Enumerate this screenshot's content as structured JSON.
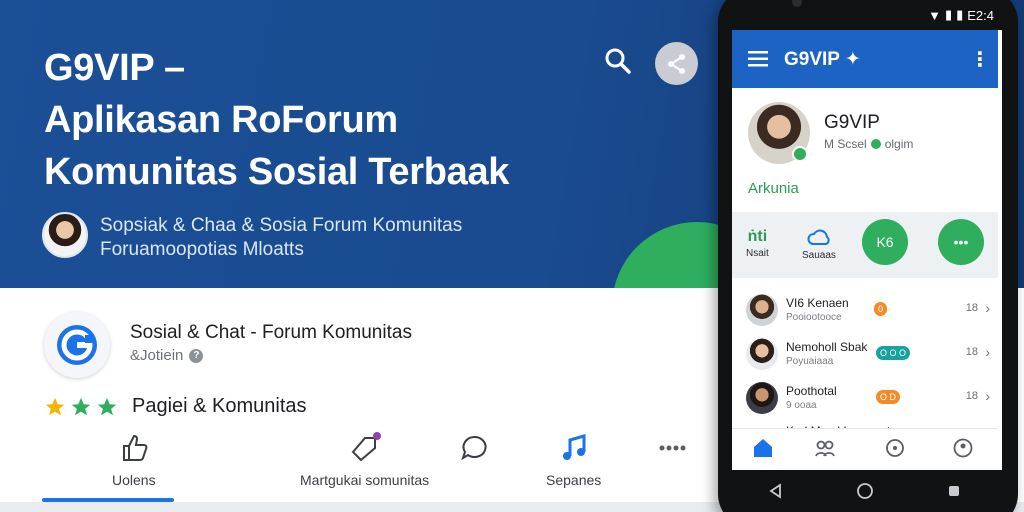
{
  "hero": {
    "title_lines": [
      "G9VIP –",
      "Aplikasan RoForum",
      "Komunitas Sosial Terbaak"
    ],
    "subtitle_lines": [
      "Sopsiak & Chaa & Sosia Forum Komunitas",
      "Foruamoopotias Mloatts"
    ],
    "icons": {
      "search": "search-icon",
      "share": "share-icon"
    },
    "accent_color": "#2fae5e",
    "background_color": "#1b4f96"
  },
  "listing": {
    "app_name": "Sosial & Chat - Forum Komunitas",
    "developer": "&Jotiein",
    "rating_text": "Pagiei & Komunitas",
    "stars": 3,
    "actions": [
      {
        "label": "Uolens",
        "icon": "thumbs-up-icon"
      },
      {
        "label": "Martgukai somunitas",
        "icon": "tag-icon"
      },
      {
        "label": "",
        "icon": "chat-icon"
      },
      {
        "label": "Sepanes",
        "icon": "music-note-icon"
      },
      {
        "label": "",
        "icon": "more-icon"
      }
    ]
  },
  "phone": {
    "status_text": "E2:4",
    "app_bar_title": "G9VIP ✦",
    "profile": {
      "name": "G9VIP",
      "handle": "M Scsel",
      "handle_suffix": "olgim",
      "section": "Arkunia"
    },
    "quick_actions": [
      {
        "label": "Nsait",
        "glyph": "ṅti"
      },
      {
        "label": "Sauaas",
        "glyph": ""
      },
      {
        "label": "",
        "glyph": "K6"
      },
      {
        "label": "",
        "glyph": "•••"
      }
    ],
    "chats": [
      {
        "name": "VI6 Kenaen",
        "sub": "Pooiootooce",
        "time": "18",
        "badge": "0"
      },
      {
        "name": "Nemoholl Sbak",
        "sub": "Poyuaiaaa",
        "time": "18",
        "badge": "O O O"
      },
      {
        "name": "Poothotal",
        "sub": "9 ooaa",
        "time": "18",
        "badge": "O D"
      },
      {
        "name": "Kod Mmol Inanonetas",
        "sub": "",
        "time": "",
        "badge": ""
      }
    ],
    "bottom_nav": [
      "home-icon",
      "groups-icon",
      "explore-icon",
      "profile-icon"
    ]
  }
}
